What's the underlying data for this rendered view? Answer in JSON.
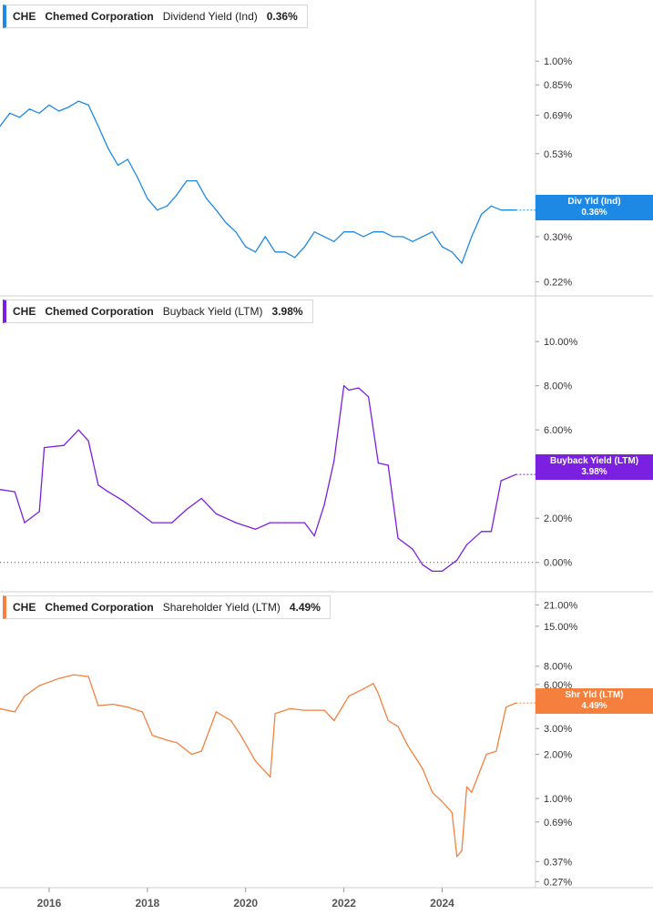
{
  "chart_data": [
    {
      "type": "line",
      "ticker": "CHE",
      "company": "Chemed Corporation",
      "metric": "Dividend Yield (Ind)",
      "current_value": "0.36%",
      "tag_label": "Div Yld (Ind)",
      "tag_value": "0.36%",
      "color": "#1e88e5",
      "scale": "log",
      "y_ticks": [
        "1.00%",
        "0.85%",
        "0.69%",
        "0.53%",
        "0.30%",
        "0.22%"
      ],
      "y_tick_values": [
        1.0,
        0.85,
        0.69,
        0.53,
        0.3,
        0.22
      ],
      "ylim": [
        0.21,
        1.2
      ],
      "x": [
        2015.0,
        2015.2,
        2015.4,
        2015.6,
        2015.8,
        2016.0,
        2016.2,
        2016.4,
        2016.6,
        2016.8,
        2017.0,
        2017.2,
        2017.4,
        2017.6,
        2017.8,
        2018.0,
        2018.2,
        2018.4,
        2018.6,
        2018.8,
        2019.0,
        2019.2,
        2019.4,
        2019.6,
        2019.8,
        2020.0,
        2020.2,
        2020.4,
        2020.6,
        2020.8,
        2021.0,
        2021.2,
        2021.4,
        2021.6,
        2021.8,
        2022.0,
        2022.2,
        2022.4,
        2022.6,
        2022.8,
        2023.0,
        2023.2,
        2023.4,
        2023.6,
        2023.8,
        2024.0,
        2024.2,
        2024.4,
        2024.6,
        2024.8,
        2025.0,
        2025.2,
        2025.5
      ],
      "values": [
        0.64,
        0.7,
        0.68,
        0.72,
        0.7,
        0.74,
        0.71,
        0.73,
        0.76,
        0.74,
        0.64,
        0.55,
        0.49,
        0.51,
        0.45,
        0.39,
        0.36,
        0.37,
        0.4,
        0.44,
        0.44,
        0.39,
        0.36,
        0.33,
        0.31,
        0.28,
        0.27,
        0.3,
        0.27,
        0.27,
        0.26,
        0.28,
        0.31,
        0.3,
        0.29,
        0.31,
        0.31,
        0.3,
        0.31,
        0.31,
        0.3,
        0.3,
        0.29,
        0.3,
        0.31,
        0.28,
        0.27,
        0.25,
        0.3,
        0.35,
        0.37,
        0.36,
        0.36
      ]
    },
    {
      "type": "line",
      "ticker": "CHE",
      "company": "Chemed Corporation",
      "metric": "Buyback Yield (LTM)",
      "current_value": "3.98%",
      "tag_label": "Buyback Yield (LTM)",
      "tag_value": "3.98%",
      "color": "#7b1fe0",
      "scale": "linear",
      "y_ticks": [
        "10.00%",
        "8.00%",
        "6.00%",
        "4.00%",
        "2.00%",
        "0.00%"
      ],
      "y_tick_values": [
        10,
        8,
        6,
        4,
        2,
        0
      ],
      "ylim": [
        -1.0,
        10.5
      ],
      "zero_line": true,
      "x": [
        2015.0,
        2015.3,
        2015.5,
        2015.8,
        2015.9,
        2016.3,
        2016.6,
        2016.8,
        2017.0,
        2017.2,
        2017.5,
        2017.8,
        2018.1,
        2018.5,
        2018.8,
        2019.1,
        2019.4,
        2019.8,
        2020.2,
        2020.5,
        2020.8,
        2021.2,
        2021.4,
        2021.6,
        2021.8,
        2022.0,
        2022.1,
        2022.3,
        2022.5,
        2022.7,
        2022.9,
        2023.1,
        2023.4,
        2023.6,
        2023.8,
        2024.0,
        2024.3,
        2024.5,
        2024.8,
        2025.0,
        2025.2,
        2025.5
      ],
      "values": [
        3.3,
        3.2,
        1.8,
        2.3,
        5.2,
        5.3,
        6.0,
        5.5,
        3.5,
        3.2,
        2.8,
        2.3,
        1.8,
        1.8,
        2.4,
        2.9,
        2.2,
        1.8,
        1.5,
        1.8,
        1.8,
        1.8,
        1.2,
        2.6,
        4.6,
        8.0,
        7.8,
        7.9,
        7.5,
        4.5,
        4.4,
        1.1,
        0.6,
        -0.1,
        -0.4,
        -0.4,
        0.1,
        0.8,
        1.4,
        1.4,
        3.7,
        3.98
      ]
    },
    {
      "type": "line",
      "ticker": "CHE",
      "company": "Chemed Corporation",
      "metric": "Shareholder Yield (LTM)",
      "current_value": "4.49%",
      "tag_label": "Shr Yld (LTM)",
      "tag_value": "4.49%",
      "color": "#f5803e",
      "scale": "log",
      "y_ticks": [
        "21.00%",
        "15.00%",
        "8.00%",
        "6.00%",
        "3.00%",
        "2.00%",
        "1.00%",
        "0.69%",
        "0.37%",
        "0.27%"
      ],
      "y_tick_values": [
        21,
        15,
        8,
        6,
        3,
        2,
        1,
        0.69,
        0.37,
        0.27
      ],
      "ylim": [
        0.26,
        23
      ],
      "x": [
        2015.0,
        2015.3,
        2015.5,
        2015.8,
        2016.2,
        2016.5,
        2016.8,
        2017.0,
        2017.3,
        2017.6,
        2017.9,
        2018.1,
        2018.4,
        2018.6,
        2018.9,
        2019.1,
        2019.4,
        2019.7,
        2019.9,
        2020.2,
        2020.5,
        2020.6,
        2020.9,
        2021.2,
        2021.6,
        2021.8,
        2022.1,
        2022.4,
        2022.6,
        2022.7,
        2022.9,
        2023.1,
        2023.3,
        2023.6,
        2023.8,
        2024.0,
        2024.2,
        2024.3,
        2024.4,
        2024.5,
        2024.6,
        2024.9,
        2025.1,
        2025.3,
        2025.5
      ],
      "values": [
        4.1,
        3.9,
        5.0,
        5.9,
        6.6,
        7.0,
        6.8,
        4.3,
        4.4,
        4.2,
        3.9,
        2.7,
        2.5,
        2.4,
        2.0,
        2.1,
        3.9,
        3.4,
        2.7,
        1.8,
        1.4,
        3.8,
        4.1,
        4.0,
        4.0,
        3.4,
        5.0,
        5.6,
        6.1,
        5.2,
        3.4,
        3.1,
        2.3,
        1.6,
        1.1,
        0.95,
        0.8,
        0.4,
        0.44,
        1.2,
        1.1,
        2.0,
        2.1,
        4.2,
        4.49
      ]
    }
  ],
  "x_axis": {
    "range": [
      2015.0,
      2025.9
    ],
    "labels": [
      "2016",
      "2018",
      "2020",
      "2022",
      "2024"
    ],
    "label_values": [
      2016,
      2018,
      2020,
      2022,
      2024
    ]
  }
}
